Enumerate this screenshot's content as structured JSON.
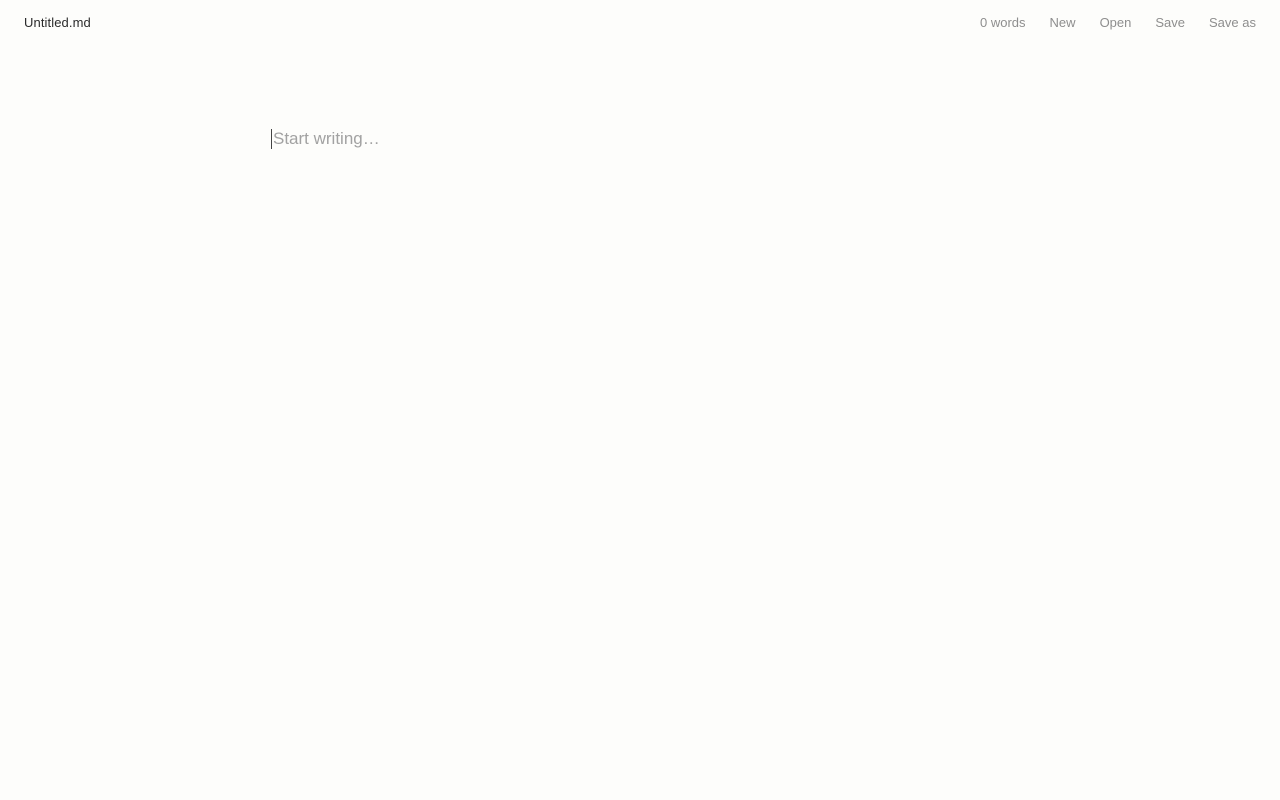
{
  "header": {
    "doc_title": "Untitled.md",
    "word_count": "0 words",
    "actions": {
      "new": "New",
      "open": "Open",
      "save": "Save",
      "save_as": "Save as"
    }
  },
  "editor": {
    "placeholder": "Start writing…"
  }
}
